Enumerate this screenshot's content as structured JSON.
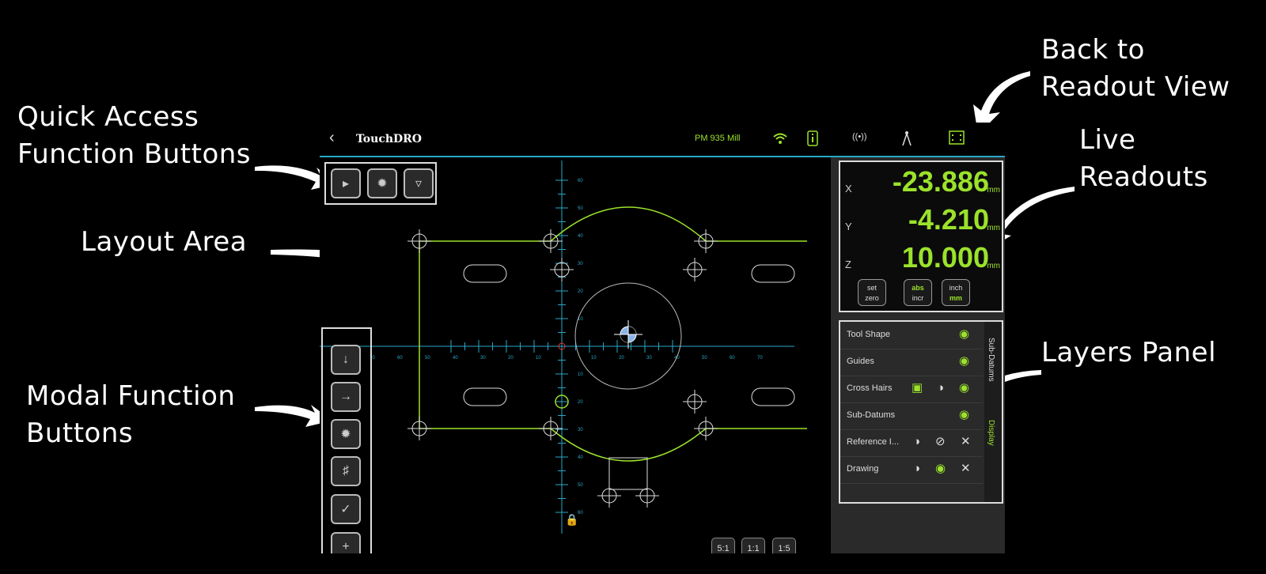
{
  "annotations": {
    "back_to_readout": "Back to\nReadout View",
    "quick_access": "Quick Access\nFunction Buttons",
    "live_readouts": "Live\nReadouts",
    "layout_area": "Layout Area",
    "layers_panel": "Layers Panel",
    "modal_buttons": "Modal Function\nButtons"
  },
  "topbar": {
    "brand": "TouchDRO",
    "machine": "PM 935 Mill"
  },
  "readout": {
    "x_label": "X",
    "x_value": "-23.886",
    "x_unit": "mm",
    "y_label": "Y",
    "y_value": "-4.210",
    "y_unit": "mm",
    "z_label": "Z",
    "z_value": "10.000",
    "z_unit": "mm",
    "set_zero_line1": "set",
    "set_zero_line2": "zero",
    "abs": "abs",
    "incr": "incr",
    "inch": "inch",
    "mm": "mm"
  },
  "layers": [
    {
      "name": "Tool Shape"
    },
    {
      "name": "Guides"
    },
    {
      "name": "Cross Hairs"
    },
    {
      "name": "Sub-Datums"
    },
    {
      "name": "Reference I..."
    },
    {
      "name": "Drawing"
    }
  ],
  "layer_tabs": {
    "sub_datums": "Sub-Datums",
    "display": "Display"
  },
  "zoom": {
    "z51": "5:1",
    "z11": "1:1",
    "z15": "1:5"
  },
  "ruler": {
    "h_ticks": [
      "70",
      "60",
      "50",
      "40",
      "30",
      "20",
      "10",
      "10",
      "20",
      "30",
      "40",
      "50",
      "60",
      "70"
    ],
    "v_ticks": [
      "60",
      "50",
      "40",
      "30",
      "20",
      "10",
      "10",
      "20",
      "30",
      "40",
      "50",
      "60"
    ]
  },
  "colors": {
    "accent": "#9be22b",
    "cyan": "#29a7c6",
    "bg": "#000000",
    "panel": "#2a2a2a"
  }
}
